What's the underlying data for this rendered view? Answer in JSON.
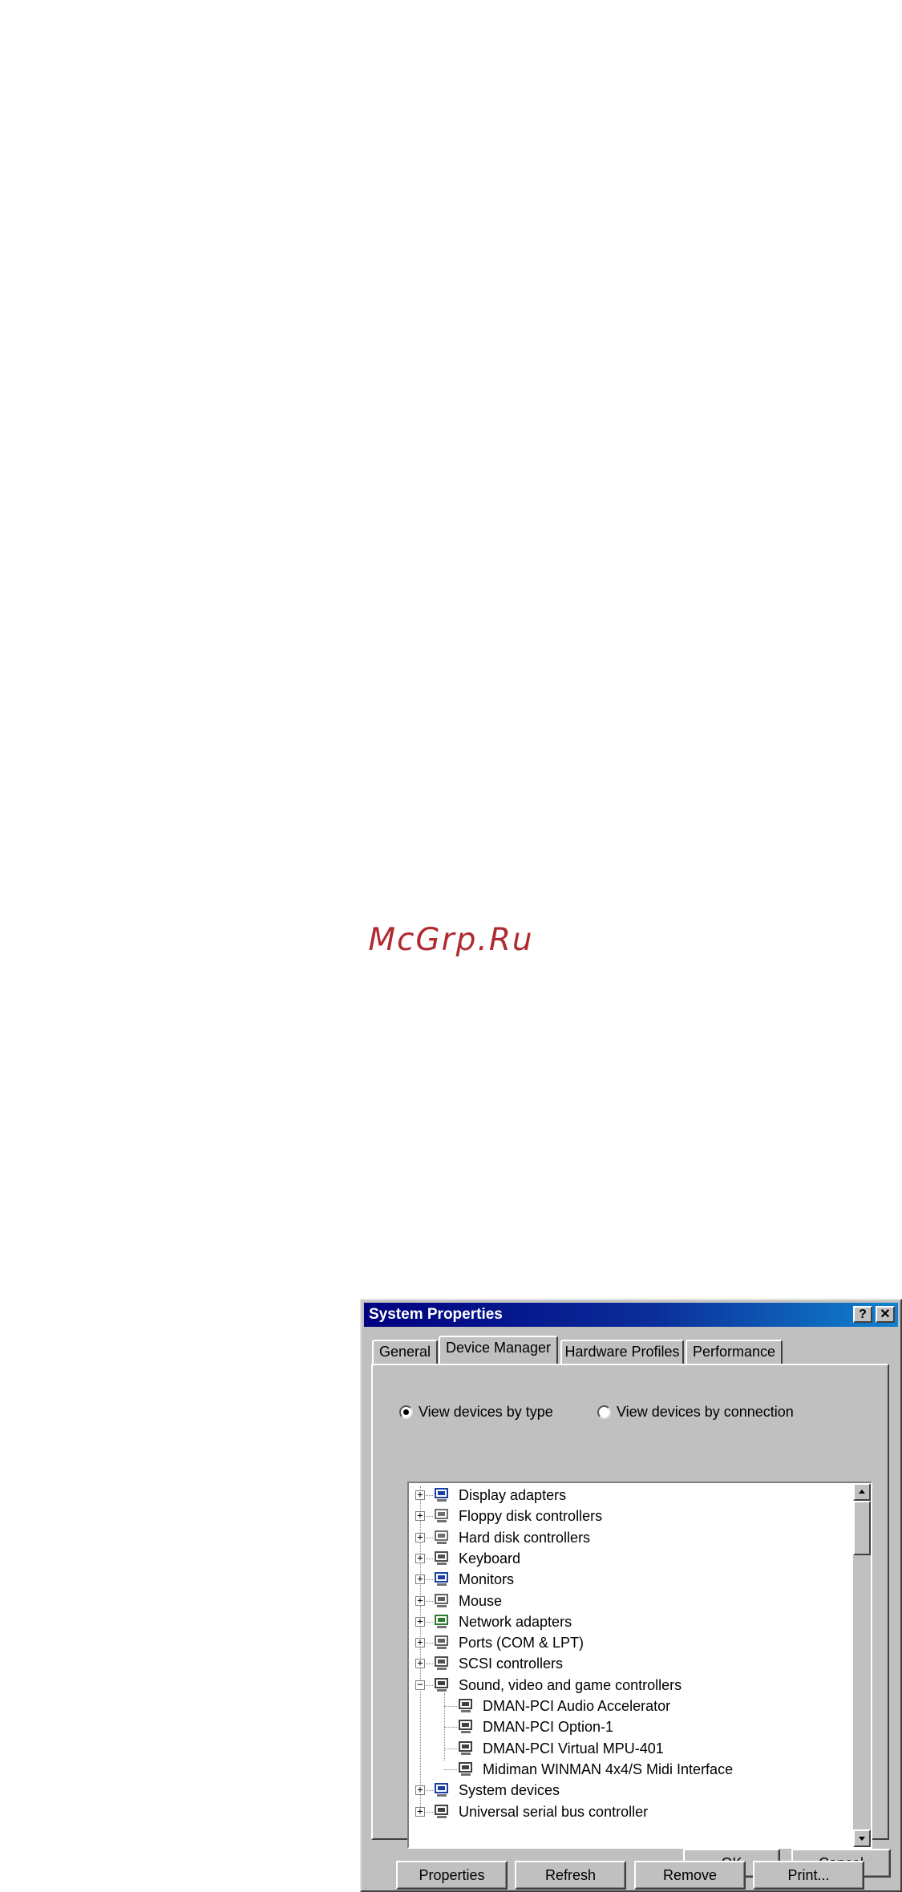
{
  "watermark": "McGrp.Ru",
  "window": {
    "title": "System Properties",
    "help_button": "?",
    "close_button": "✕"
  },
  "tabs": [
    {
      "label": "General",
      "active": false
    },
    {
      "label": "Device Manager",
      "active": true
    },
    {
      "label": "Hardware Profiles",
      "active": false
    },
    {
      "label": "Performance",
      "active": false
    }
  ],
  "view_options": [
    {
      "label": "View devices by type",
      "selected": true
    },
    {
      "label": "View devices by connection",
      "selected": false
    }
  ],
  "tree": [
    {
      "label": "Display adapters",
      "level": 0,
      "expander": "+",
      "icon": "display-adapter-icon"
    },
    {
      "label": "Floppy disk controllers",
      "level": 0,
      "expander": "+",
      "icon": "floppy-controller-icon"
    },
    {
      "label": "Hard disk controllers",
      "level": 0,
      "expander": "+",
      "icon": "hard-disk-controller-icon"
    },
    {
      "label": "Keyboard",
      "level": 0,
      "expander": "+",
      "icon": "keyboard-icon"
    },
    {
      "label": "Monitors",
      "level": 0,
      "expander": "+",
      "icon": "monitor-icon"
    },
    {
      "label": "Mouse",
      "level": 0,
      "expander": "+",
      "icon": "mouse-icon"
    },
    {
      "label": "Network adapters",
      "level": 0,
      "expander": "+",
      "icon": "network-adapter-icon"
    },
    {
      "label": "Ports (COM & LPT)",
      "level": 0,
      "expander": "+",
      "icon": "port-icon"
    },
    {
      "label": "SCSI controllers",
      "level": 0,
      "expander": "+",
      "icon": "scsi-controller-icon"
    },
    {
      "label": "Sound, video and game controllers",
      "level": 0,
      "expander": "−",
      "icon": "sound-controller-icon"
    },
    {
      "label": "DMAN-PCI Audio Accelerator",
      "level": 1,
      "expander": "",
      "icon": "sound-device-icon"
    },
    {
      "label": "DMAN-PCI Option-1",
      "level": 1,
      "expander": "",
      "icon": "sound-device-icon"
    },
    {
      "label": "DMAN-PCI Virtual MPU-401",
      "level": 1,
      "expander": "",
      "icon": "sound-device-icon"
    },
    {
      "label": "Midiman WINMAN 4x4/S Midi Interface",
      "level": 1,
      "expander": "",
      "icon": "sound-device-icon"
    },
    {
      "label": "System devices",
      "level": 0,
      "expander": "+",
      "icon": "system-device-icon"
    },
    {
      "label": "Universal serial bus controller",
      "level": 0,
      "expander": "+",
      "icon": "usb-controller-icon"
    }
  ],
  "buttons": {
    "properties": "Properties",
    "refresh": "Refresh",
    "remove": "Remove",
    "print": "Print...",
    "ok": "OK",
    "cancel": "Cancel"
  },
  "colors": {
    "title_bar": "#000080",
    "dialog_face": "#c0c0c0",
    "watermark": "#b02a30"
  }
}
